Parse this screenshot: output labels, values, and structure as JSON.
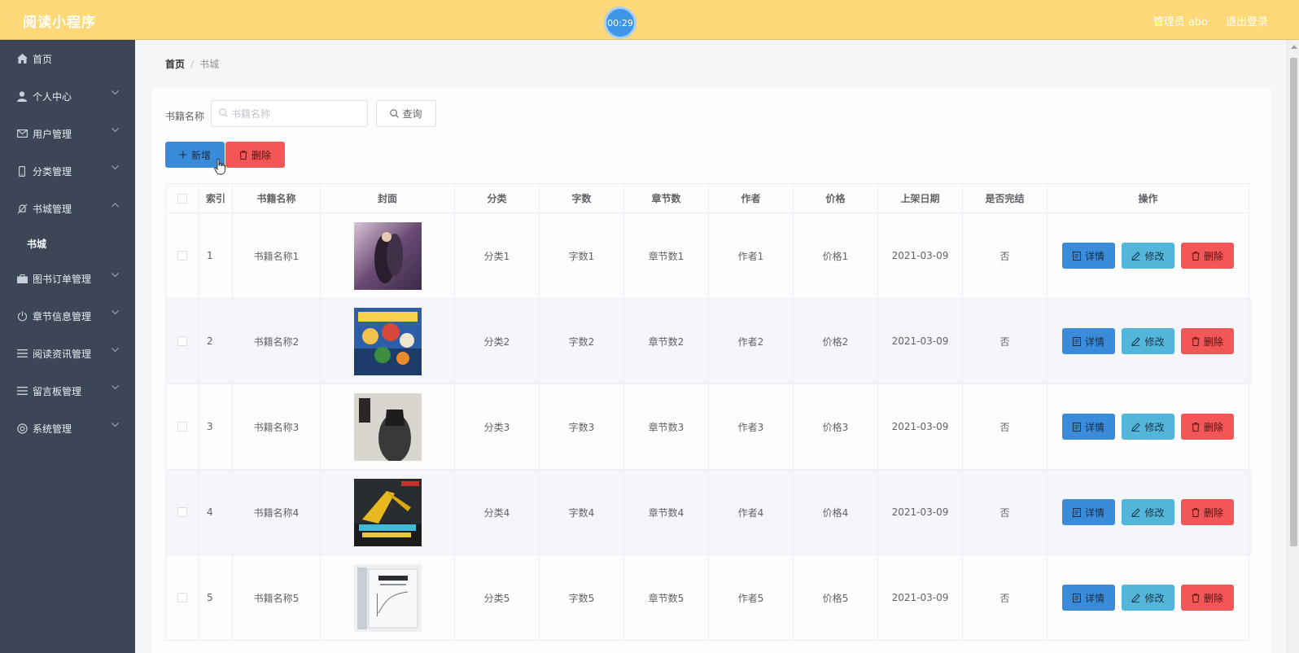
{
  "header": {
    "app_title": "阅读小程序",
    "timer": "00:29",
    "user": "管理员 abo",
    "logout": "退出登录"
  },
  "sidebar": {
    "items": [
      {
        "label": "首页",
        "icon": "home-icon"
      },
      {
        "label": "个人中心",
        "icon": "user-icon"
      },
      {
        "label": "用户管理",
        "icon": "mail-icon"
      },
      {
        "label": "分类管理",
        "icon": "mobile-icon"
      },
      {
        "label": "书城管理",
        "icon": "bell-off-icon"
      },
      {
        "label": "书城",
        "icon": ""
      },
      {
        "label": "图书订单管理",
        "icon": "suitcase-icon"
      },
      {
        "label": "章节信息管理",
        "icon": "power-icon"
      },
      {
        "label": "阅读资讯管理",
        "icon": "menu-icon"
      },
      {
        "label": "留言板管理",
        "icon": "menu-icon"
      },
      {
        "label": "系统管理",
        "icon": "setting-icon"
      }
    ]
  },
  "breadcrumb": {
    "home": "首页",
    "separator": "/",
    "current": "书城"
  },
  "search": {
    "label": "书籍名称",
    "placeholder": "书籍名称",
    "value": "",
    "query_button": "查询"
  },
  "actions": {
    "add": "新增",
    "delete": "删除"
  },
  "table": {
    "columns": [
      "索引",
      "书籍名称",
      "封面",
      "分类",
      "字数",
      "章节数",
      "作者",
      "价格",
      "上架日期",
      "是否完结",
      "操作"
    ],
    "rows": [
      {
        "index": "1",
        "name": "书籍名称1",
        "category": "分类1",
        "words": "字数1",
        "chapters": "章节数1",
        "author": "作者1",
        "price": "价格1",
        "date": "2021-03-09",
        "finished": "否"
      },
      {
        "index": "2",
        "name": "书籍名称2",
        "category": "分类2",
        "words": "字数2",
        "chapters": "章节数2",
        "author": "作者2",
        "price": "价格2",
        "date": "2021-03-09",
        "finished": "否"
      },
      {
        "index": "3",
        "name": "书籍名称3",
        "category": "分类3",
        "words": "字数3",
        "chapters": "章节数3",
        "author": "作者3",
        "price": "价格3",
        "date": "2021-03-09",
        "finished": "否"
      },
      {
        "index": "4",
        "name": "书籍名称4",
        "category": "分类4",
        "words": "字数4",
        "chapters": "章节数4",
        "author": "作者4",
        "price": "价格4",
        "date": "2021-03-09",
        "finished": "否"
      },
      {
        "index": "5",
        "name": "书籍名称5",
        "category": "分类5",
        "words": "字数5",
        "chapters": "章节数5",
        "author": "作者5",
        "price": "价格5",
        "date": "2021-03-09",
        "finished": "否"
      }
    ],
    "row_actions": {
      "detail": "详情",
      "edit": "修改",
      "delete": "删除"
    }
  },
  "colors": {
    "header_bg": "#fdd878",
    "sidebar_bg": "#3d4656",
    "primary": "#3a8bd9",
    "info": "#54b5da",
    "danger": "#f25656"
  }
}
